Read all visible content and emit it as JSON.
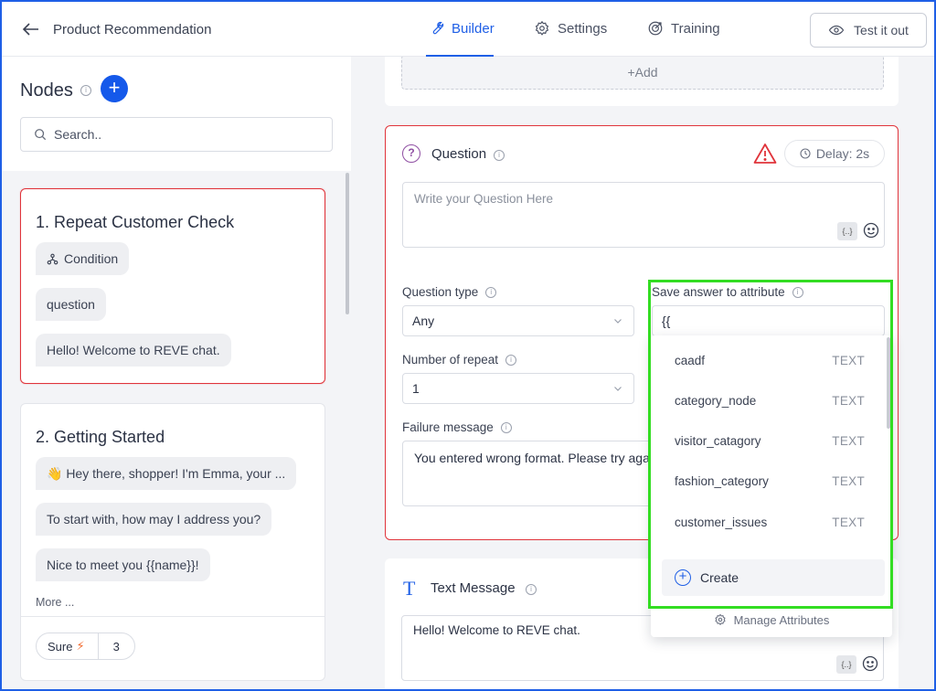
{
  "header": {
    "title": "Product Recommendation",
    "tabs": [
      {
        "label": "Builder",
        "active": true
      },
      {
        "label": "Settings",
        "active": false
      },
      {
        "label": "Training",
        "active": false
      }
    ],
    "test_button": "Test it out"
  },
  "sidebar": {
    "title": "Nodes",
    "search_placeholder": "Search..",
    "nodes": [
      {
        "title": "1. Repeat Customer Check",
        "chips": [
          "Condition",
          "question",
          "Hello! Welcome to REVE chat."
        ]
      },
      {
        "title": "2. Getting Started",
        "chips": [
          "👋 Hey there, shopper! I'm Emma, your ...",
          "To start with, how may I address you?",
          "Nice to meet you {{name}}!"
        ],
        "more": "More ...",
        "reply": {
          "label": "Sure",
          "count": "3"
        }
      }
    ]
  },
  "canvas": {
    "add_label": "+Add",
    "question": {
      "title": "Question",
      "delay": "Delay: 2s",
      "placeholder": "Write your Question Here",
      "question_type_label": "Question type",
      "question_type_value": "Any",
      "repeat_label": "Number of repeat",
      "repeat_value": "1",
      "failure_label": "Failure message",
      "failure_value": "You entered wrong format. Please try again",
      "save_label": "Save answer to attribute",
      "save_value": "{{"
    },
    "text_message": {
      "title": "Text Message",
      "value": "Hello! Welcome to REVE chat."
    }
  },
  "attribute_dropdown": {
    "items": [
      {
        "name": "caadf",
        "type": "TEXT"
      },
      {
        "name": "category_node",
        "type": "TEXT"
      },
      {
        "name": "visitor_catagory",
        "type": "TEXT"
      },
      {
        "name": "fashion_category",
        "type": "TEXT"
      },
      {
        "name": "customer_issues",
        "type": "TEXT"
      }
    ],
    "create_label": "Create",
    "manage_label": "Manage Attributes"
  },
  "colors": {
    "accent": "#1f5fe6",
    "error": "#e0343b",
    "highlight": "#33dd22"
  }
}
